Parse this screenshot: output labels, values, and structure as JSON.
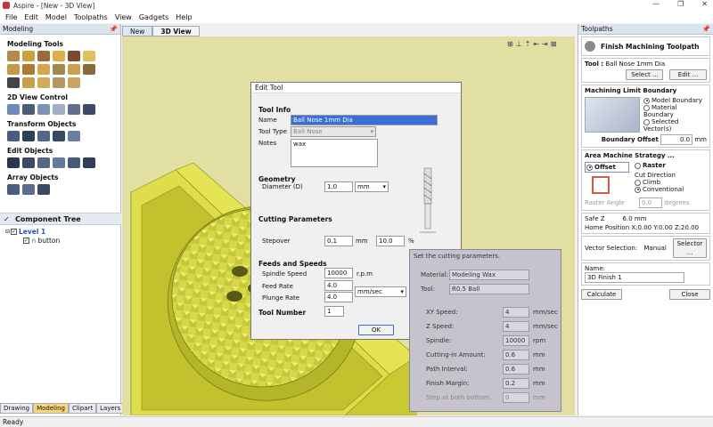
{
  "window": {
    "title": "Aspire - [New - 3D View]"
  },
  "menu": [
    "File",
    "Edit",
    "Model",
    "Toolpaths",
    "View",
    "Gadgets",
    "Help"
  ],
  "left_panel": {
    "header": "Modeling",
    "sections": {
      "modeling_tools": "Modeling Tools",
      "view_control": "2D View Control",
      "transform": "Transform Objects",
      "edit": "Edit Objects",
      "array": "Array Objects"
    },
    "component_tree": {
      "title": "Component Tree",
      "level": "Level 1",
      "item": "button"
    },
    "bottom_tabs": [
      "Drawing",
      "Modeling",
      "Clipart",
      "Layers"
    ]
  },
  "view_tabs": [
    "New",
    "3D View"
  ],
  "right_panel": {
    "header": "Toolpaths",
    "title": "Finish Machining Toolpath",
    "tool_label": "Tool :",
    "tool_name": "Ball Nose 1mm Dia",
    "select_btn": "Select ...",
    "edit_btn": "Edit ...",
    "boundary": {
      "title": "Machining Limit Boundary",
      "options": [
        "Model Boundary",
        "Material Boundary",
        "Selected Vector(s)"
      ],
      "offset_label": "Boundary Offset",
      "offset_value": "0.0",
      "offset_unit": "mm"
    },
    "strategy": {
      "title": "Area Machine Strategy ...",
      "offset": "Offset",
      "raster": "Raster",
      "cut_direction": "Cut Direction",
      "climb": "Climb",
      "conventional": "Conventional",
      "raster_angle_label": "Raster Angle",
      "raster_angle_value": "0.0",
      "raster_angle_unit": "degrees"
    },
    "safe_z_label": "Safe Z",
    "safe_z_value": "6.0 mm",
    "home_label": "Home Position",
    "home_value": "X:0.00 Y:0.00 Z:20.00",
    "vector_sel_label": "Vector Selection:",
    "vector_sel_value": "Manual",
    "selector_btn": "Selector ...",
    "name_label": "Name:",
    "name_value": "3D Finish 1",
    "calculate_btn": "Calculate",
    "close_btn": "Close"
  },
  "dialog": {
    "title": "Edit Tool",
    "tool_info": "Tool Info",
    "name_label": "Name",
    "name_value": "Ball Nose 1mm Dia",
    "type_label": "Tool Type",
    "type_value": "Ball Nose",
    "notes_label": "Notes",
    "notes_value": "wax",
    "geometry": "Geometry",
    "diameter_label": "Diameter (D)",
    "diameter_value": "1.0",
    "diameter_unit": "mm",
    "cutting_params": "Cutting Parameters",
    "stepover_label": "Stepover",
    "stepover_value": "0.1",
    "stepover_unit": "mm",
    "stepover_pct": "10.0",
    "pct_sign": "%",
    "feeds": "Feeds and Speeds",
    "spindle_label": "Spindle Speed",
    "spindle_value": "10000",
    "spindle_unit": "r.p.m",
    "feed_label": "Feed Rate",
    "feed_value": "4.0",
    "feed_unit": "mm/sec",
    "plunge_label": "Plunge Rate",
    "plunge_value": "4.0",
    "tool_number_label": "Tool Number",
    "tool_number_value": "1",
    "ok_btn": "OK"
  },
  "photo": {
    "caption": "Set the cutting parameters.",
    "material_label": "Material:",
    "material_value": "Modeling Wax",
    "tool_label": "Tool:",
    "tool_value": "R0.5 Ball",
    "rows": [
      {
        "label": "XY Speed:",
        "value": "4",
        "unit": "mm/sec"
      },
      {
        "label": "Z Speed:",
        "value": "4",
        "unit": "mm/sec"
      },
      {
        "label": "Spindle:",
        "value": "10000",
        "unit": "rpm"
      },
      {
        "label": "Cutting-in Amount:",
        "value": "0.6",
        "unit": "mm"
      },
      {
        "label": "Path Interval:",
        "value": "0.6",
        "unit": "mm"
      },
      {
        "label": "Finish Margin:",
        "value": "0.2",
        "unit": "mm"
      },
      {
        "label": "Step at both bottom:",
        "value": "0",
        "unit": "mm"
      }
    ]
  },
  "status": "Ready"
}
